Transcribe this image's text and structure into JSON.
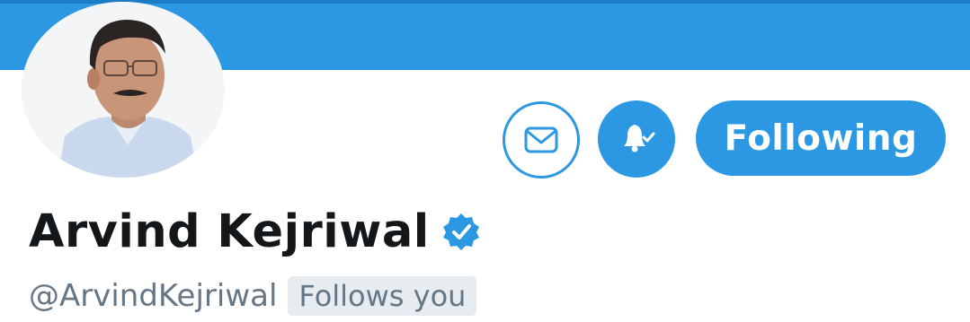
{
  "profile": {
    "display_name": "Arvind Kejriwal",
    "handle": "@ArvindKejriwal",
    "follows_badge": "Follows you",
    "verified": true
  },
  "actions": {
    "following_label": "Following",
    "message_icon": "envelope-icon",
    "notify_icon": "bell-check-icon"
  },
  "colors": {
    "accent": "#2c98e3",
    "name_text": "#14171a",
    "secondary_text": "#657786",
    "badge_bg": "#e6ecf0"
  }
}
